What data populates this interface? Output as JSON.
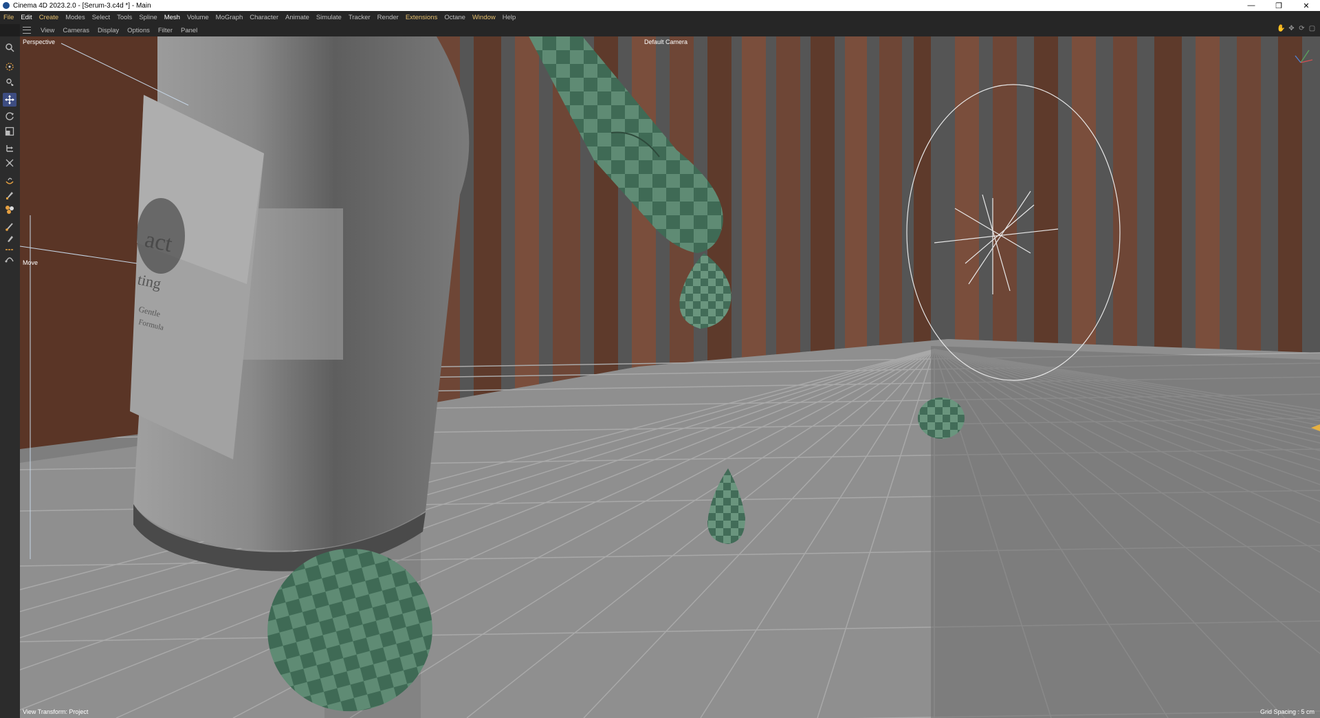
{
  "window": {
    "title": "Cinema 4D 2023.2.0 - [Serum-3.c4d *] - Main",
    "controls": [
      "—",
      "❐",
      "✕"
    ]
  },
  "menubar": {
    "items": [
      {
        "label": "File"
      },
      {
        "label": "Edit"
      },
      {
        "label": "Create"
      },
      {
        "label": "Modes"
      },
      {
        "label": "Select"
      },
      {
        "label": "Tools"
      },
      {
        "label": "Spline"
      },
      {
        "label": "Mesh"
      },
      {
        "label": "Volume"
      },
      {
        "label": "MoGraph"
      },
      {
        "label": "Character"
      },
      {
        "label": "Animate"
      },
      {
        "label": "Simulate"
      },
      {
        "label": "Tracker"
      },
      {
        "label": "Render"
      },
      {
        "label": "Extensions"
      },
      {
        "label": "Octane"
      },
      {
        "label": "Window"
      },
      {
        "label": "Help"
      }
    ]
  },
  "viewport_menu": {
    "items": [
      {
        "label": "View"
      },
      {
        "label": "Cameras"
      },
      {
        "label": "Display"
      },
      {
        "label": "Options"
      },
      {
        "label": "Filter"
      },
      {
        "label": "Panel"
      }
    ],
    "icons": [
      "hand-icon",
      "move-view-icon",
      "rotate-view-icon",
      "maximize-icon"
    ]
  },
  "viewport": {
    "projection": "Perspective",
    "camera": "Default Camera",
    "active_tool_hint": "Move",
    "view_transform": "View Transform: Project",
    "grid_spacing": "Grid Spacing : 5 cm",
    "label_text_fragments": [
      "act",
      "ting",
      "Gentle",
      "Formula"
    ]
  },
  "left_toolbar": {
    "tools": [
      {
        "name": "search-icon"
      },
      {
        "name": "live-selection-icon"
      },
      {
        "name": "object-axis-icon"
      },
      {
        "name": "move-tool-icon",
        "active": true
      },
      {
        "name": "rotate-tool-icon"
      },
      {
        "name": "scale-tool-icon"
      },
      {
        "name": "transform-icon"
      },
      {
        "name": "snap-icon"
      },
      {
        "name": "lasso-icon"
      },
      {
        "name": "knife-icon"
      },
      {
        "name": "material-icon"
      },
      {
        "name": "brush-icon"
      },
      {
        "name": "pen-icon"
      },
      {
        "name": "line-icon"
      },
      {
        "name": "spline-pen-icon"
      }
    ]
  },
  "colors": {
    "accent": "#e6c070",
    "active_tool": "#3d4d82",
    "wall_wood": "#6a4130",
    "floor": "#8f8f8f",
    "drop_green": "#5e8a72"
  }
}
